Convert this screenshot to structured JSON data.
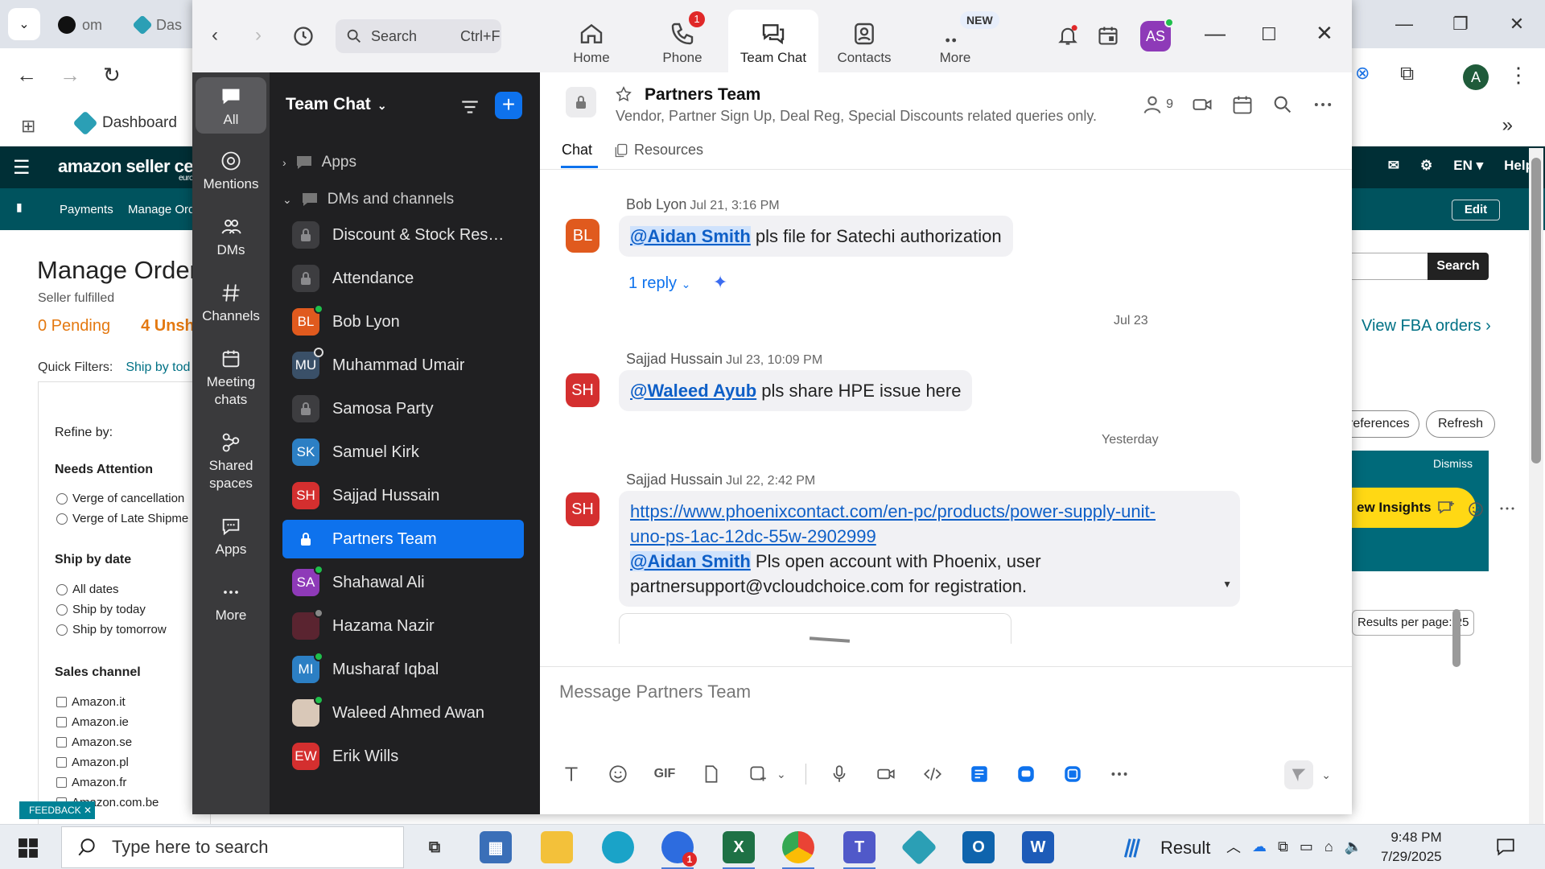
{
  "browser": {
    "tabs": [
      {
        "label": "om"
      },
      {
        "label": "Das"
      }
    ],
    "bookmark": "Dashboard",
    "profile_initial": "A"
  },
  "amazon": {
    "logo": "amazon seller central",
    "logo_sub": "europe",
    "nav": [
      "Payments",
      "Manage Ord"
    ],
    "top_right": [
      "EN ▾",
      "Help"
    ],
    "edit_label": "Edit",
    "page_title": "Manage Order",
    "subtitle": "Seller fulfilled",
    "tab_pending": "0 Pending",
    "tab_unshipped": "4 Unsh",
    "quick_filters_label": "Quick Filters:",
    "quick_filter_1": "Ship by tod",
    "refine_by": "Refine by:",
    "needs_attention": "Needs Attention",
    "needs_options": [
      "Verge of cancellation",
      "Verge of Late Shipme"
    ],
    "ship_by_date": "Ship by date",
    "ship_options": [
      "All dates",
      "Ship by today",
      "Ship by tomorrow"
    ],
    "sales_channel": "Sales channel",
    "channels": [
      "Amazon.it",
      "Amazon.ie",
      "Amazon.se",
      "Amazon.pl",
      "Amazon.fr",
      "Amazon.com.be"
    ],
    "search_btn": "Search",
    "view_fba": "View FBA orders ›",
    "preferences_btn": "references",
    "refresh_btn": "Refresh",
    "dismiss": "Dismiss",
    "insights": "ew Insights",
    "results_per_page": "Results per page: 25",
    "feedback": "FEEDBACK ✕"
  },
  "zoom": {
    "search_placeholder": "Search",
    "search_shortcut": "Ctrl+F",
    "tabs": [
      {
        "label": "Home"
      },
      {
        "label": "Phone",
        "badge": "1"
      },
      {
        "label": "Team Chat"
      },
      {
        "label": "Contacts"
      },
      {
        "label": "More",
        "badge": "NEW"
      }
    ],
    "avatar_initials": "AS",
    "rail": [
      "All",
      "Mentions",
      "DMs",
      "Channels",
      "Meeting chats",
      "Shared spaces",
      "Apps",
      "More"
    ],
    "list_title": "Team Chat",
    "section_apps": "Apps",
    "section_dms": "DMs and channels",
    "items": [
      {
        "name": "Discount & Stock Reser..."
      },
      {
        "name": "Attendance"
      },
      {
        "name": "Bob Lyon",
        "initials": "BL"
      },
      {
        "name": "Muhammad Umair",
        "initials": "MU"
      },
      {
        "name": "Samosa Party"
      },
      {
        "name": "Samuel Kirk",
        "initials": "SK"
      },
      {
        "name": "Sajjad Hussain",
        "initials": "SH"
      },
      {
        "name": "Partners Team"
      },
      {
        "name": "Shahawal Ali",
        "initials": "SA"
      },
      {
        "name": "Hazama Nazir"
      },
      {
        "name": "Musharaf Iqbal",
        "initials": "MI"
      },
      {
        "name": "Waleed Ahmed Awan"
      },
      {
        "name": "Erik Wills",
        "initials": "EW"
      }
    ],
    "channel": {
      "title": "Partners Team",
      "description": "Vendor, Partner Sign Up, Deal Reg, Special Discounts related queries only.",
      "member_count": "9",
      "tab_chat": "Chat",
      "tab_resources": "Resources"
    },
    "messages": [
      {
        "initials": "BL",
        "sender": "Bob Lyon",
        "time": "Jul 21, 3:16 PM",
        "mention": "@Aidan Smith",
        "text": " pls file for Satechi authorization",
        "reply": "1 reply"
      },
      {
        "date_sep": "Jul 23",
        "initials": "SH",
        "sender": "Sajjad Hussain",
        "time": "Jul 23, 10:09 PM",
        "mention": "@Waleed Ayub",
        "text": " pls share HPE issue here"
      },
      {
        "date_sep": "Yesterday",
        "initials": "SH",
        "sender": "Sajjad Hussain",
        "time": "Jul 22, 2:42 PM",
        "link_line1": "https://www.phoenixcontact.com/en-pc/products/power-supply-unit-",
        "link_line2": "uno-ps-1ac-12dc-55w-2902999",
        "mention": "@Aidan Smith",
        "text_line1": " Pls open account with Phoenix, user",
        "text_line2": "partnersupport@vcloudchoice.com for registration."
      }
    ],
    "compose_placeholder": "Message Partners Team",
    "gif_label": "GIF"
  },
  "taskbar": {
    "search_placeholder": "Type here to search",
    "weather": "Result",
    "time": "9:48 PM",
    "date": "7/29/2025",
    "zoom_badge": "1"
  },
  "colors": {
    "zoom_blue": "#0e72ed",
    "rail_bg": "#3a3a3c",
    "list_bg": "#202022",
    "amazon_dark": "#002f36",
    "amazon_nav": "#00535e"
  }
}
